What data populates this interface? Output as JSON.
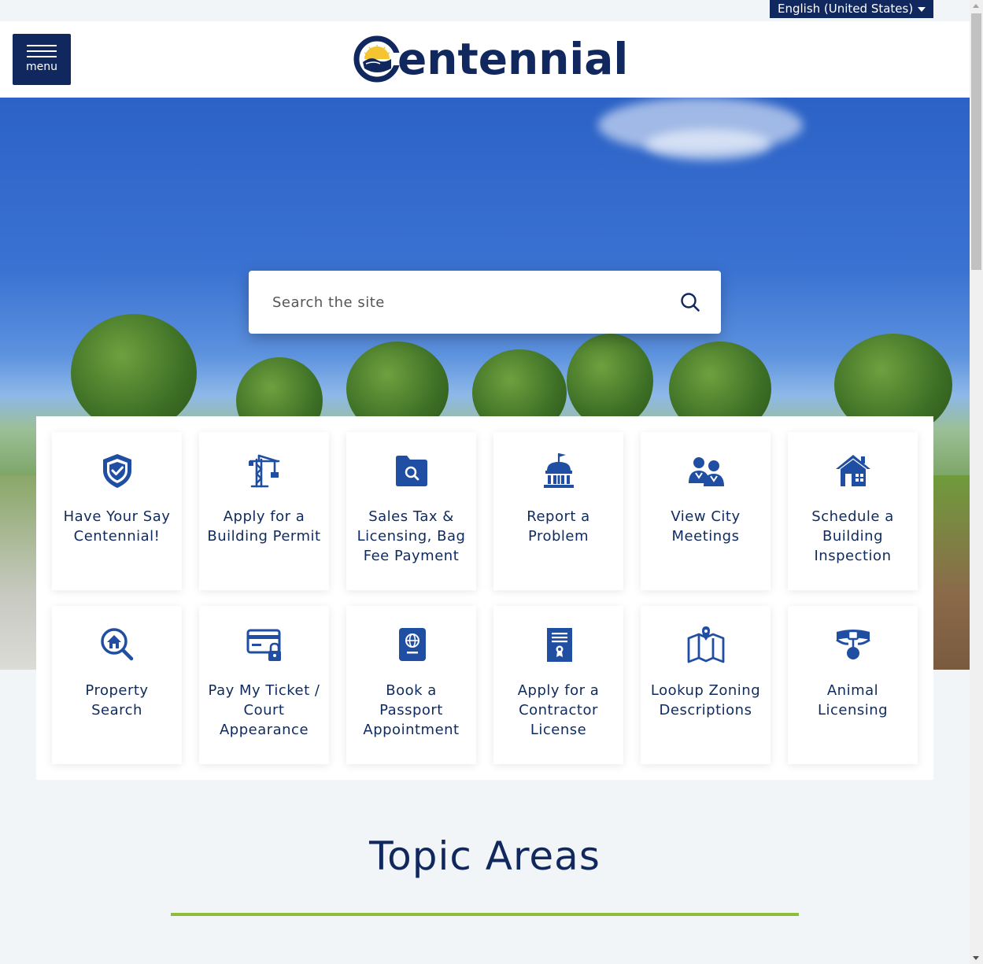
{
  "language": {
    "selected": "English (United States)"
  },
  "header": {
    "menu_label": "menu",
    "logo_text": "entennial"
  },
  "search": {
    "placeholder": "Search the site"
  },
  "quick_links": [
    {
      "label": "Have Your Say Centennial!",
      "icon": "shield-check-icon"
    },
    {
      "label": "Apply for a Building Permit",
      "icon": "construction-crane-icon"
    },
    {
      "label": "Sales Tax & Licensing, Bag Fee Payment",
      "icon": "folder-search-icon"
    },
    {
      "label": "Report a Problem",
      "icon": "city-hall-icon"
    },
    {
      "label": "View City Meetings",
      "icon": "people-icon"
    },
    {
      "label": "Schedule a Building Inspection",
      "icon": "house-icon"
    },
    {
      "label": "Property Search",
      "icon": "house-magnifier-icon"
    },
    {
      "label": "Pay My Ticket / Court Appearance",
      "icon": "card-lock-icon"
    },
    {
      "label": "Book a Passport Appointment",
      "icon": "passport-icon"
    },
    {
      "label": "Apply for a Contractor License",
      "icon": "license-certificate-icon"
    },
    {
      "label": "Lookup Zoning Descriptions",
      "icon": "map-pin-icon"
    },
    {
      "label": "Animal Licensing",
      "icon": "pet-collar-icon"
    }
  ],
  "topic_areas": {
    "title": "Topic Areas"
  },
  "colors": {
    "navy": "#10285e",
    "accent_green": "#8fbd3a",
    "tile_icon": "#1f4ea3"
  }
}
